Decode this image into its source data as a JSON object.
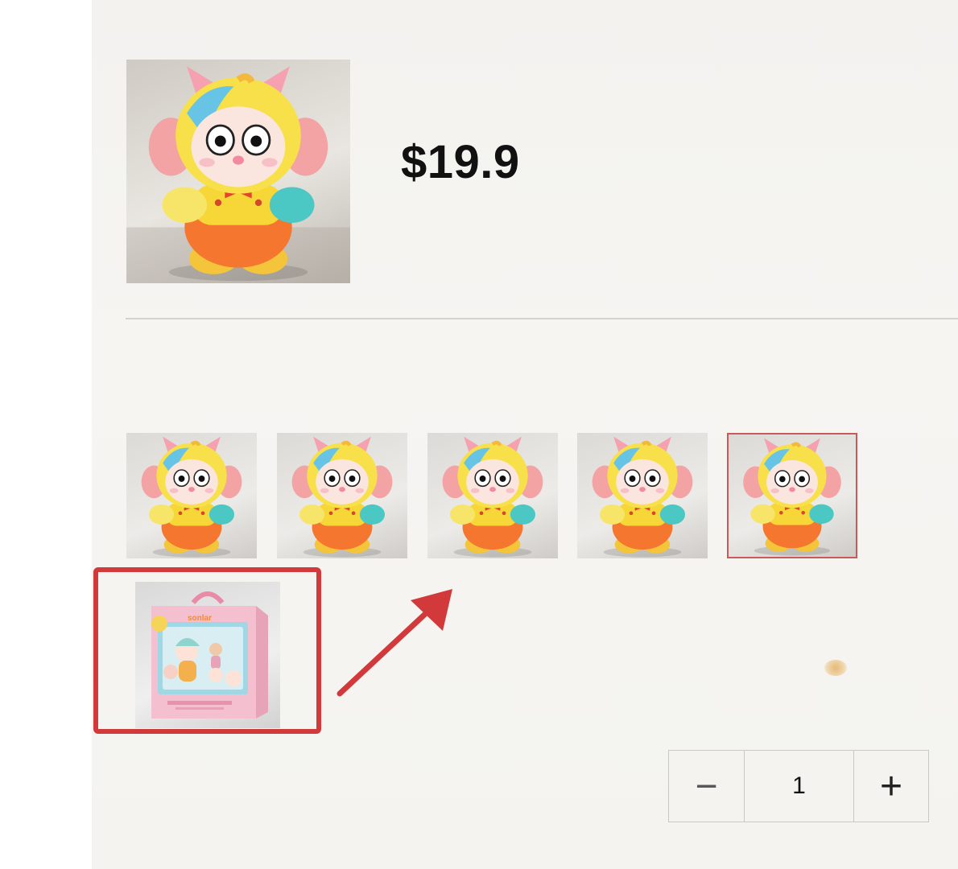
{
  "product": {
    "price": "$19.9",
    "main_image_icon": "plush-toy-image"
  },
  "variants": [
    {
      "icon": "plush-toy-variant-1",
      "selected": false
    },
    {
      "icon": "plush-toy-variant-2",
      "selected": false
    },
    {
      "icon": "plush-toy-variant-3",
      "selected": false
    },
    {
      "icon": "plush-toy-variant-4",
      "selected": false
    },
    {
      "icon": "plush-toy-variant-5",
      "selected": true
    }
  ],
  "box_option": {
    "brand": "sonlar",
    "icon": "gift-box-image"
  },
  "quantity": {
    "minus_label": "−",
    "value": "1",
    "plus_label": "+"
  },
  "colors": {
    "annotation_red": "#d2393b",
    "selected_border": "#c85a5a",
    "price_text": "#111111"
  }
}
